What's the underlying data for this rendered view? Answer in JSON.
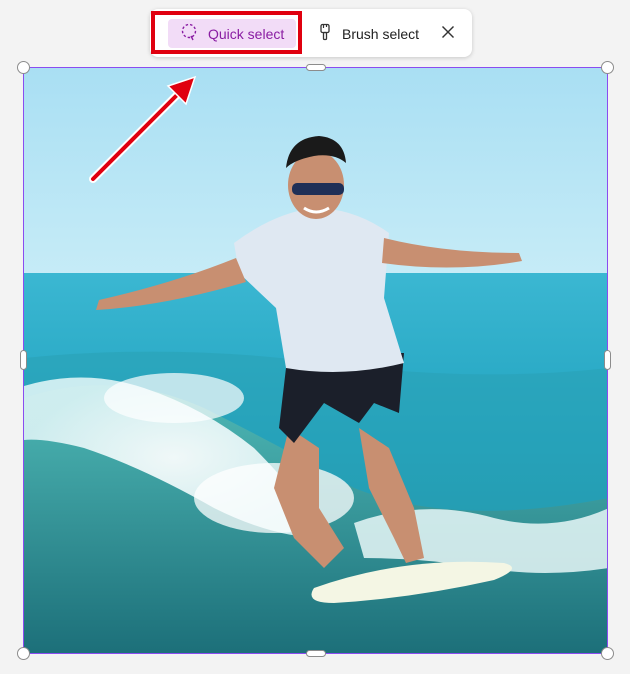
{
  "toolbar": {
    "quick_select_label": "Quick select",
    "brush_select_label": "Brush select",
    "quick_select_icon": "lasso-select-icon",
    "brush_select_icon": "brush-icon",
    "close_icon": "close-icon"
  },
  "colors": {
    "accent": "#8a1da3",
    "selected_bg": "#f2dcf7",
    "selection_border": "#8a4cf0",
    "annotation_red": "#e0000f"
  },
  "image": {
    "subject": "surfer-photo"
  }
}
